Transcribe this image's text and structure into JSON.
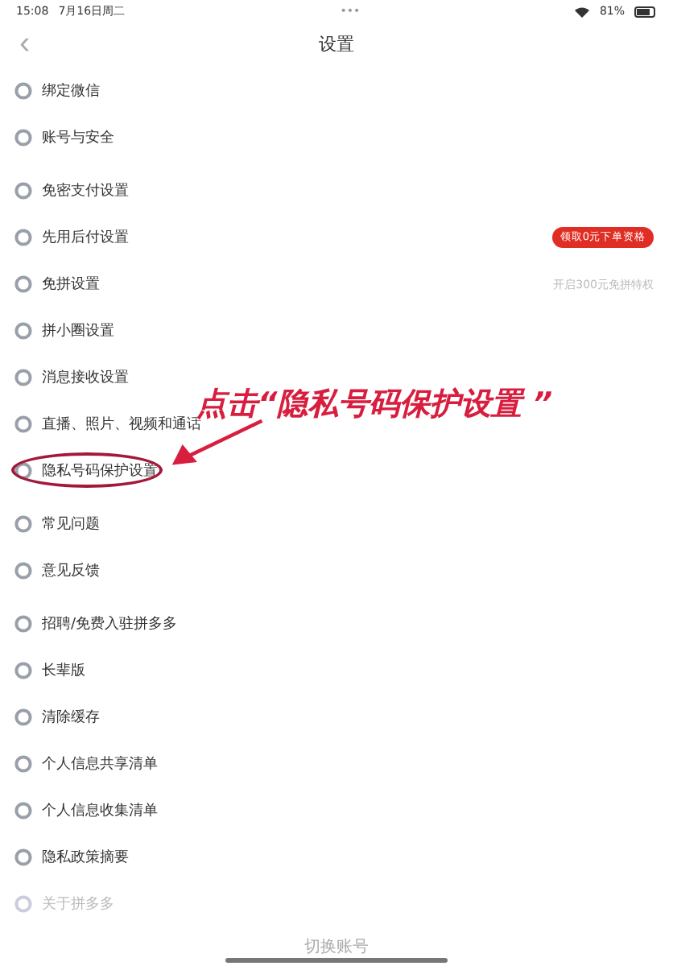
{
  "status_bar": {
    "time": "15:08",
    "date": "7月16日周二",
    "dots": "•••",
    "battery": "81%"
  },
  "nav": {
    "back": "‹",
    "title": "设置"
  },
  "groups": [
    {
      "items": [
        {
          "label": "绑定微信",
          "dimmed": false,
          "circled": false
        },
        {
          "label": "账号与安全",
          "dimmed": false,
          "circled": false
        }
      ]
    },
    {
      "items": [
        {
          "label": "免密支付设置",
          "dimmed": false,
          "circled": false
        },
        {
          "label": "先用后付设置",
          "badge": "领取0元下单资格",
          "dimmed": false,
          "circled": false
        },
        {
          "label": "免拼设置",
          "note": "开启300元免拼特权",
          "dimmed": false,
          "circled": false
        },
        {
          "label": "拼小圈设置",
          "dimmed": false,
          "circled": false
        },
        {
          "label": "消息接收设置",
          "dimmed": false,
          "circled": false
        },
        {
          "label": "直播、照片、视频和通话",
          "dimmed": false,
          "circled": false
        },
        {
          "label": "隐私号码保护设置",
          "dimmed": false,
          "circled": true
        }
      ]
    },
    {
      "items": [
        {
          "label": "常见问题",
          "dimmed": false,
          "circled": false
        },
        {
          "label": "意见反馈",
          "dimmed": false,
          "circled": false
        }
      ]
    },
    {
      "items": [
        {
          "label": "招聘/免费入驻拼多多",
          "dimmed": false,
          "circled": false
        },
        {
          "label": "长辈版",
          "dimmed": false,
          "circled": false
        },
        {
          "label": "清除缓存",
          "dimmed": false,
          "circled": false
        },
        {
          "label": "个人信息共享清单",
          "dimmed": false,
          "circled": false
        },
        {
          "label": "个人信息收集清单",
          "dimmed": false,
          "circled": false
        },
        {
          "label": "隐私政策摘要",
          "dimmed": false,
          "circled": false
        },
        {
          "label": "关于拼多多",
          "dimmed": true,
          "circled": false
        }
      ]
    }
  ],
  "footer": {
    "label": "切换账号"
  },
  "annotation": {
    "text": "点击“隐私号码保护设置 ”"
  }
}
